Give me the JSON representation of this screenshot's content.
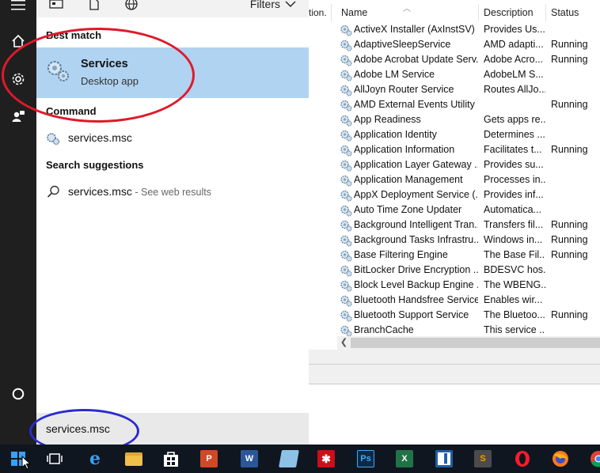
{
  "services_window": {
    "truncated_header": "tion.",
    "columns": {
      "name": "Name",
      "description": "Description",
      "status": "Status"
    },
    "rows": [
      {
        "name": "ActiveX Installer (AxInstSV)",
        "description": "Provides Us...",
        "status": ""
      },
      {
        "name": "AdaptiveSleepService",
        "description": "AMD adapti...",
        "status": "Running"
      },
      {
        "name": "Adobe Acrobat Update Serv...",
        "description": "Adobe Acro...",
        "status": "Running"
      },
      {
        "name": "Adobe LM Service",
        "description": "AdobeLM S...",
        "status": ""
      },
      {
        "name": "AllJoyn Router Service",
        "description": "Routes AllJo...",
        "status": ""
      },
      {
        "name": "AMD External Events Utility",
        "description": "",
        "status": "Running"
      },
      {
        "name": "App Readiness",
        "description": "Gets apps re...",
        "status": ""
      },
      {
        "name": "Application Identity",
        "description": "Determines ...",
        "status": ""
      },
      {
        "name": "Application Information",
        "description": "Facilitates t...",
        "status": "Running"
      },
      {
        "name": "Application Layer Gateway ...",
        "description": "Provides su...",
        "status": ""
      },
      {
        "name": "Application Management",
        "description": "Processes in...",
        "status": ""
      },
      {
        "name": "AppX Deployment Service (...",
        "description": "Provides inf...",
        "status": ""
      },
      {
        "name": "Auto Time Zone Updater",
        "description": "Automatica...",
        "status": ""
      },
      {
        "name": "Background Intelligent Tran...",
        "description": "Transfers fil...",
        "status": "Running"
      },
      {
        "name": "Background Tasks Infrastru...",
        "description": "Windows in...",
        "status": "Running"
      },
      {
        "name": "Base Filtering Engine",
        "description": "The Base Fil...",
        "status": "Running"
      },
      {
        "name": "BitLocker Drive Encryption ...",
        "description": "BDESVC hos...",
        "status": ""
      },
      {
        "name": "Block Level Backup Engine ...",
        "description": "The WBENG...",
        "status": ""
      },
      {
        "name": "Bluetooth Handsfree Service",
        "description": "Enables wir...",
        "status": ""
      },
      {
        "name": "Bluetooth Support Service",
        "description": "The Bluetoo...",
        "status": "Running"
      },
      {
        "name": "BranchCache",
        "description": "This service ...",
        "status": ""
      }
    ]
  },
  "search_panel": {
    "filters_label": "Filters",
    "best_match_label": "Best match",
    "best_match": {
      "title": "Services",
      "subtitle": "Desktop app"
    },
    "command_label": "Command",
    "command_result": "services.msc",
    "suggestions_label": "Search suggestions",
    "web_result": {
      "text": "services.msc",
      "suffix": " - See web results"
    },
    "query": "services.msc"
  },
  "colors": {
    "highlight": "#b0d3f1",
    "red_annotation": "#e0192b",
    "blue_annotation": "#2b2bcf",
    "taskbar": "#0f1620"
  },
  "taskbar_items": [
    "start-icon",
    "task-view-icon",
    "edge-icon",
    "file-explorer-icon",
    "store-icon",
    "powerpoint-icon",
    "word-icon",
    "notepad-icon",
    "acrobat-icon",
    "photoshop-icon",
    "excel-icon",
    "app-icon",
    "sublime-icon",
    "opera-icon",
    "firefox-icon",
    "chrome-icon"
  ]
}
